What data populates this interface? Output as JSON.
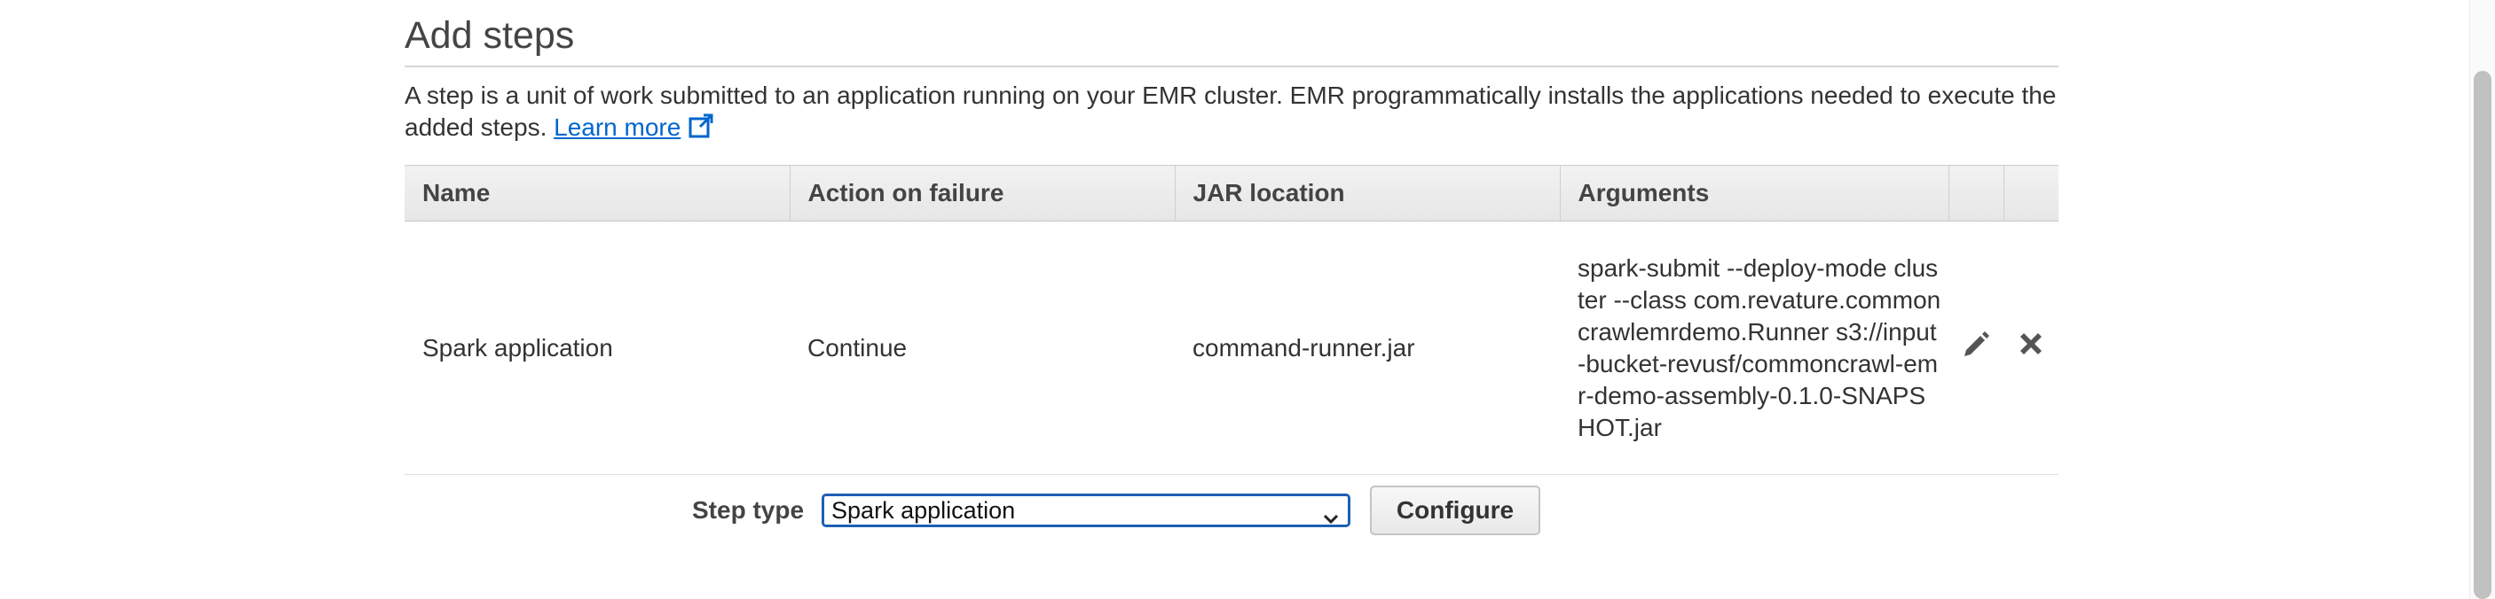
{
  "section": {
    "title": "Add steps",
    "description": "A step is a unit of work submitted to an application running on your EMR cluster. EMR programmatically installs the applications needed to execute the added steps.",
    "learn_more": "Learn more"
  },
  "table": {
    "headers": {
      "name": "Name",
      "action": "Action on failure",
      "jar": "JAR location",
      "args": "Arguments"
    },
    "rows": [
      {
        "name": "Spark application",
        "action": "Continue",
        "jar": "command-runner.jar",
        "args": "spark-submit --deploy-mode cluster --class com.revature.commoncrawlemrdemo.Runner s3://input-bucket-revusf/commoncrawl-emr-demo-assembly-0.1.0-SNAPSHOT.jar",
        "edit_icon": "pencil-icon",
        "delete_icon": "x-icon"
      }
    ]
  },
  "step_type": {
    "label": "Step type",
    "selected": "Spark application",
    "configure_label": "Configure"
  },
  "colors": {
    "link": "#0066cc",
    "select_border": "#1e5fb4",
    "icon": "#555555"
  }
}
